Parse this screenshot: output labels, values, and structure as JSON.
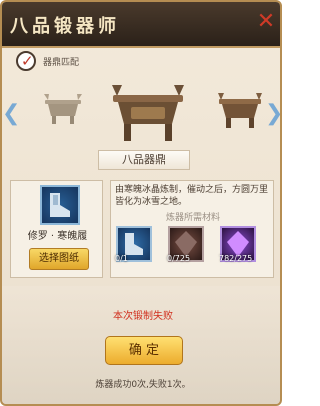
{
  "header": {
    "title": "八品锻器师"
  },
  "matcher": {
    "label": "器鼎匹配"
  },
  "cauldron": {
    "selected_name": "八品器鼎"
  },
  "item": {
    "name": "修罗 · 寒魄履",
    "button_label": "选择图纸"
  },
  "recipe": {
    "description": "由寒魄冰晶炼制，催动之后，方圆万里皆化为冰雪之地。",
    "materials_title": "炼器所需材料",
    "materials": [
      {
        "icon": "boots-icon",
        "count": "0/1"
      },
      {
        "icon": "dark-crystal-icon",
        "count": "0/725"
      },
      {
        "icon": "purple-crystal-icon",
        "count": "782/275"
      }
    ]
  },
  "result": {
    "message": "本次锻制失败"
  },
  "actions": {
    "confirm_label": "确 定"
  },
  "stats": {
    "text": "炼器成功0次,失败1次。"
  },
  "colors": {
    "fail": "#d1301f",
    "button_gold": "#ecac2d",
    "close": "#cf3a27"
  }
}
